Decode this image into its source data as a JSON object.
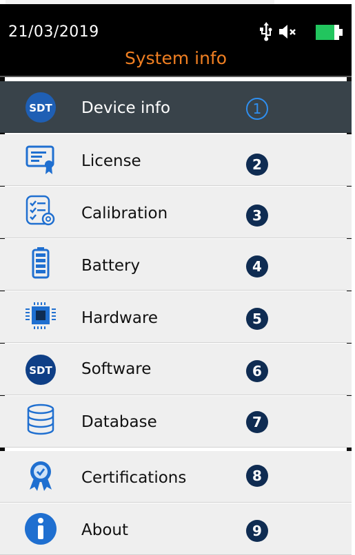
{
  "status_bar": {
    "date": "21/03/2019",
    "icons": [
      "usb-icon",
      "speaker-muted-icon",
      "battery-icon"
    ],
    "battery_color": "#22c55e"
  },
  "header": {
    "title": "System info",
    "title_color": "#f07f22"
  },
  "menu": {
    "items": [
      {
        "label": "Device info",
        "number": "1",
        "icon": "sdt-logo-icon",
        "selected": true
      },
      {
        "label": "License",
        "number": "2",
        "icon": "license-certificate-icon",
        "selected": false
      },
      {
        "label": "Calibration",
        "number": "3",
        "icon": "calibration-checklist-icon",
        "selected": false
      },
      {
        "label": "Battery",
        "number": "4",
        "icon": "battery-level-icon",
        "selected": false
      },
      {
        "label": "Hardware",
        "number": "5",
        "icon": "chip-icon",
        "selected": false
      },
      {
        "label": "Software",
        "number": "6",
        "icon": "sdt-logo-icon",
        "selected": false
      },
      {
        "label": "Database",
        "number": "7",
        "icon": "database-icon",
        "selected": false
      },
      {
        "label": "Certifications",
        "number": "8",
        "icon": "award-badge-icon",
        "selected": false
      },
      {
        "label": "About",
        "number": "9",
        "icon": "info-icon",
        "selected": false
      }
    ]
  },
  "colors": {
    "accent": "#2f8ff0",
    "number_badge": "#0f2c52",
    "selected_row": "#39434a"
  }
}
